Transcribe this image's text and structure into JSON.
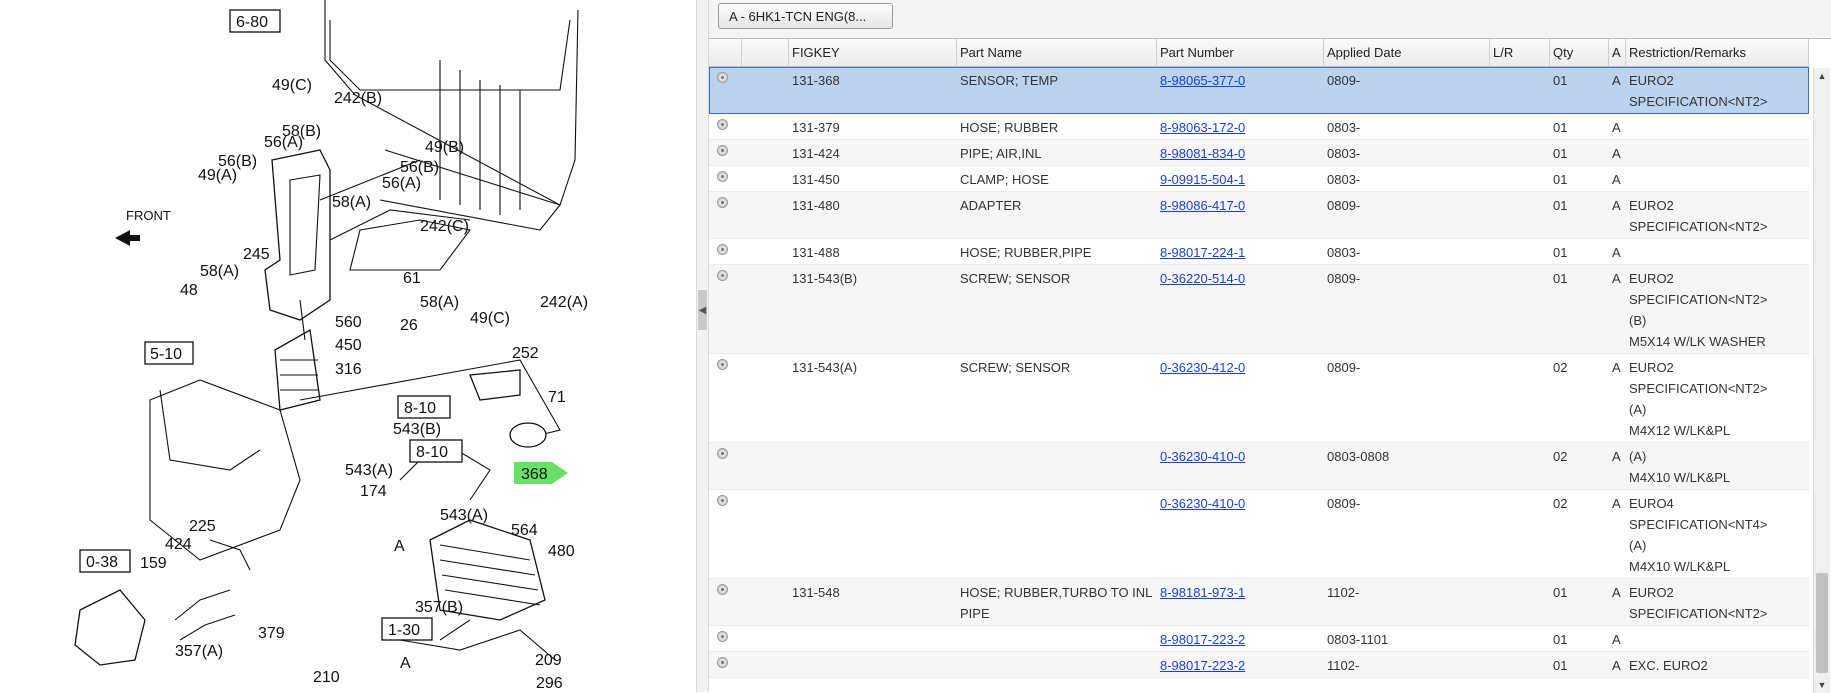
{
  "diagram": {
    "front_label": "FRONT",
    "ref_boxes": [
      "6-80",
      "5-10",
      "8-10",
      "8-10",
      "0-38",
      "1-30"
    ],
    "callouts": [
      "49(C)",
      "242(B)",
      "58(B)",
      "56(A)",
      "56(B)",
      "49(A)",
      "56(A)",
      "56(B)",
      "49(B)",
      "58(A)",
      "242(C)",
      "245",
      "58(A)",
      "48",
      "61",
      "58(A)",
      "49(C)",
      "242(A)",
      "560",
      "26",
      "450",
      "316",
      "252",
      "71",
      "543(B)",
      "368",
      "543(A)",
      "174",
      "543(A)",
      "225",
      "424",
      "159",
      "564",
      "480",
      "357(B)",
      "379",
      "357(A)",
      "209",
      "210",
      "296",
      "A",
      "A"
    ],
    "highlight_color": "#66e066"
  },
  "toolbar": {
    "engine_button": "A - 6HK1-TCN ENG(8..."
  },
  "grid": {
    "columns": [
      "",
      "",
      "FIGKEY",
      "Part Name",
      "Part Number",
      "Applied Date",
      "L/R",
      "Qty",
      "A",
      "Restriction/Remarks"
    ],
    "rows": [
      {
        "figkey": "131-368",
        "part_name": "SENSOR; TEMP",
        "part_number": "8-98065-377-0",
        "applied_date": "0809-",
        "lr": "",
        "qty": "01",
        "a": "A",
        "remarks": [
          "EURO2",
          "SPECIFICATION<NT2>"
        ],
        "selected": true
      },
      {
        "figkey": "131-379",
        "part_name": "HOSE; RUBBER",
        "part_number": "8-98063-172-0",
        "applied_date": "0803-",
        "lr": "",
        "qty": "01",
        "a": "A",
        "remarks": []
      },
      {
        "figkey": "131-424",
        "part_name": "PIPE; AIR,INL",
        "part_number": "8-98081-834-0",
        "applied_date": "0803-",
        "lr": "",
        "qty": "01",
        "a": "A",
        "remarks": []
      },
      {
        "figkey": "131-450",
        "part_name": "CLAMP; HOSE",
        "part_number": "9-09915-504-1",
        "applied_date": "0803-",
        "lr": "",
        "qty": "01",
        "a": "A",
        "remarks": []
      },
      {
        "figkey": "131-480",
        "part_name": "ADAPTER",
        "part_number": "8-98086-417-0",
        "applied_date": "0809-",
        "lr": "",
        "qty": "01",
        "a": "A",
        "remarks": [
          "EURO2",
          "SPECIFICATION<NT2>"
        ]
      },
      {
        "figkey": "131-488",
        "part_name": "HOSE; RUBBER,PIPE",
        "part_number": "8-98017-224-1",
        "applied_date": "0803-",
        "lr": "",
        "qty": "01",
        "a": "A",
        "remarks": []
      },
      {
        "figkey": "131-543(B)",
        "part_name": "SCREW; SENSOR",
        "part_number": "0-36220-514-0",
        "applied_date": "0809-",
        "lr": "",
        "qty": "01",
        "a": "A",
        "remarks": [
          "EURO2",
          "SPECIFICATION<NT2>",
          "(B)",
          "M5X14 W/LK WASHER"
        ]
      },
      {
        "figkey": "131-543(A)",
        "part_name": "SCREW; SENSOR",
        "part_number": "0-36230-412-0",
        "applied_date": "0809-",
        "lr": "",
        "qty": "02",
        "a": "A",
        "remarks": [
          "EURO2",
          "SPECIFICATION<NT2>",
          "(A)",
          "M4X12 W/LK&PL"
        ]
      },
      {
        "figkey": "",
        "part_name": "",
        "part_number": "0-36230-410-0",
        "applied_date": "0803-0808",
        "lr": "",
        "qty": "02",
        "a": "A",
        "remarks": [
          "(A)",
          "M4X10 W/LK&PL"
        ]
      },
      {
        "figkey": "",
        "part_name": "",
        "part_number": "0-36230-410-0",
        "applied_date": "0809-",
        "lr": "",
        "qty": "02",
        "a": "A",
        "remarks": [
          "EURO4",
          "SPECIFICATION<NT4>",
          "(A)",
          "M4X10 W/LK&PL"
        ]
      },
      {
        "figkey": "131-548",
        "part_name": "HOSE; RUBBER,TURBO TO INL PIPE",
        "part_number": "8-98181-973-1",
        "applied_date": "1102-",
        "lr": "",
        "qty": "01",
        "a": "A",
        "remarks": [
          "EURO2",
          "SPECIFICATION<NT2>"
        ]
      },
      {
        "figkey": "",
        "part_name": "",
        "part_number": "8-98017-223-2",
        "applied_date": "0803-1101",
        "lr": "",
        "qty": "01",
        "a": "A",
        "remarks": []
      },
      {
        "figkey": "",
        "part_name": "",
        "part_number": "8-98017-223-2",
        "applied_date": "1102-",
        "lr": "",
        "qty": "01",
        "a": "A",
        "remarks": [
          "EXC. EURO2"
        ]
      }
    ]
  },
  "colors": {
    "link": "#1a3fd6",
    "selected_row": "#bcd3f0",
    "selected_border": "#3d6fb6"
  }
}
